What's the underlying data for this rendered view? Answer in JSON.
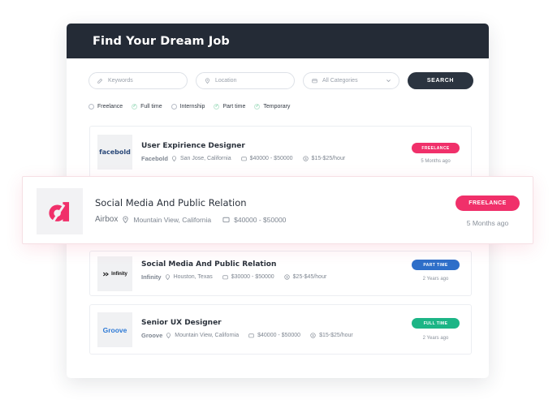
{
  "header": {
    "title": "Find Your Dream Job"
  },
  "search": {
    "keywords_placeholder": "Keywords",
    "location_placeholder": "Location",
    "category_value": "All Categories",
    "button_label": "SEARCH"
  },
  "filters": [
    {
      "label": "Freelance",
      "checked": false
    },
    {
      "label": "Full time",
      "checked": true
    },
    {
      "label": "Internship",
      "checked": false
    },
    {
      "label": "Part time",
      "checked": true
    },
    {
      "label": "Temporary",
      "checked": true
    }
  ],
  "jobs": [
    {
      "title": "User Expirience Designer",
      "company": "Facebold",
      "logo_text": "facebold",
      "location": "San Jose, California",
      "salary": "$40000 - $50000",
      "rate": "$15-$25/hour",
      "badge": "FREELANCE",
      "badge_color": "#f0306a",
      "posted": "5 Months ago"
    },
    {
      "title": "Social Media And Public Relation",
      "company": "Infinity",
      "logo_text": "Infinity",
      "location": "Houston, Texas",
      "salary": "$30000 - $50000",
      "rate": "$25-$45/hour",
      "badge": "PART TIME",
      "badge_color": "#2e6fc9",
      "posted": "2 Years ago"
    },
    {
      "title": "Senior UX Designer",
      "company": "Groove",
      "logo_text": "Groove",
      "location": "Mountain View, California",
      "salary": "$40000 - $50000",
      "rate": "$15-$25/hour",
      "badge": "FULL TIME",
      "badge_color": "#1cb586",
      "posted": "2 Years ago"
    }
  ],
  "featured": {
    "title": "Social Media And Public Relation",
    "company": "Airbox",
    "location": "Mountain View, California",
    "salary": "$40000 - $50000",
    "badge": "FREELANCE",
    "badge_color": "#f0306a",
    "posted": "5 Months ago",
    "logo_color": "#f0306a"
  }
}
